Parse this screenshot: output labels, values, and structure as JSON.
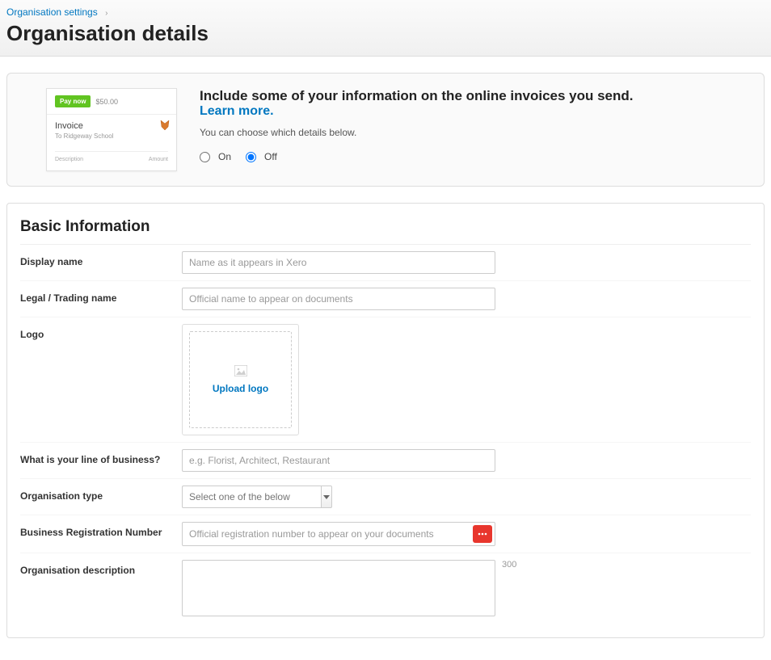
{
  "breadcrumb": {
    "parent": "Organisation settings"
  },
  "page_title": "Organisation details",
  "info_panel": {
    "heading": "Include some of your information on the online invoices you send.",
    "learn_more": "Learn more.",
    "desc": "You can choose which details below.",
    "radio_on": "On",
    "radio_off": "Off"
  },
  "invoice_preview": {
    "paynow": "Pay now",
    "amount": "$50.00",
    "title": "Invoice",
    "to": "To Ridgeway School",
    "col_desc": "Description",
    "col_amount": "Amount"
  },
  "basic": {
    "title": "Basic Information",
    "display_name": {
      "label": "Display name",
      "placeholder": "Name as it appears in Xero"
    },
    "legal_name": {
      "label": "Legal / Trading name",
      "placeholder": "Official name to appear on documents"
    },
    "logo": {
      "label": "Logo",
      "upload_text": "Upload logo"
    },
    "line_of_business": {
      "label": "What is your line of business?",
      "placeholder": "e.g. Florist, Architect, Restaurant"
    },
    "org_type": {
      "label": "Organisation type",
      "placeholder": "Select one of the below"
    },
    "brn": {
      "label": "Business Registration Number",
      "placeholder": "Official registration number to appear on your documents"
    },
    "description": {
      "label": "Organisation description",
      "char_limit": "300"
    }
  }
}
